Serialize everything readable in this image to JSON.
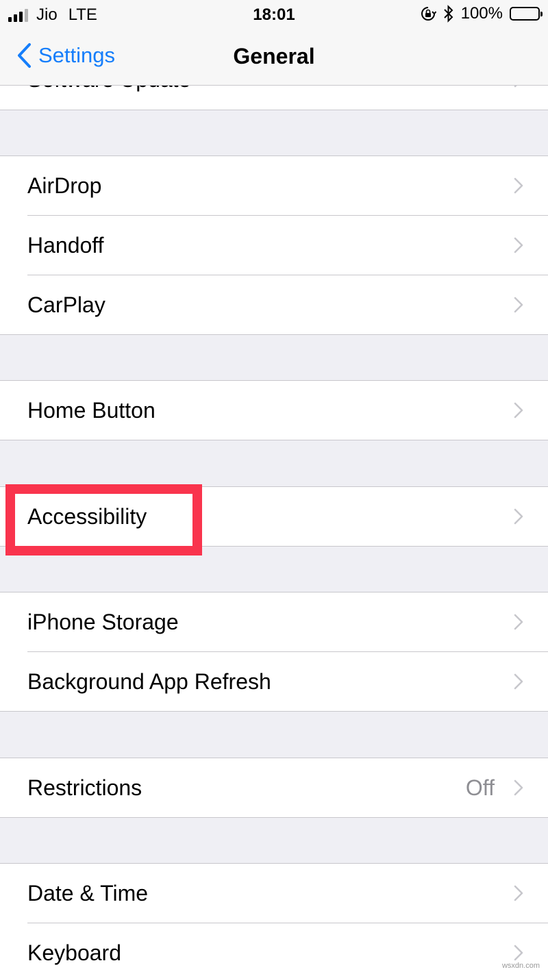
{
  "status_bar": {
    "carrier": "Jio",
    "network": "LTE",
    "time": "18:01",
    "battery": "100%"
  },
  "nav": {
    "back_label": "Settings",
    "title": "General"
  },
  "groups": [
    {
      "items": [
        {
          "label": "Software Update"
        }
      ]
    },
    {
      "items": [
        {
          "label": "AirDrop"
        },
        {
          "label": "Handoff"
        },
        {
          "label": "CarPlay"
        }
      ]
    },
    {
      "items": [
        {
          "label": "Home Button"
        }
      ]
    },
    {
      "items": [
        {
          "label": "Accessibility"
        }
      ]
    },
    {
      "items": [
        {
          "label": "iPhone Storage"
        },
        {
          "label": "Background App Refresh"
        }
      ]
    },
    {
      "items": [
        {
          "label": "Restrictions",
          "value": "Off"
        }
      ]
    },
    {
      "items": [
        {
          "label": "Date & Time"
        },
        {
          "label": "Keyboard"
        }
      ]
    }
  ],
  "watermark": "wsxdn.com",
  "colors": {
    "accent": "#157efb",
    "highlight": "#f9344d",
    "group_bg": "#efeff4"
  }
}
